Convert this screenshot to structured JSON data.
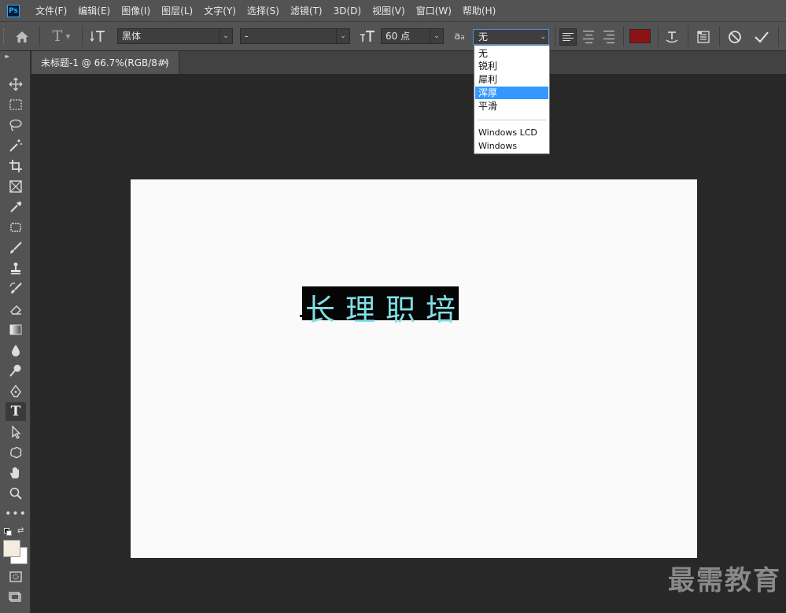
{
  "app": {
    "logo_text": "Ps"
  },
  "menu": [
    "文件(F)",
    "编辑(E)",
    "图像(I)",
    "图层(L)",
    "文字(Y)",
    "选择(S)",
    "滤镜(T)",
    "3D(D)",
    "视图(V)",
    "窗口(W)",
    "帮助(H)"
  ],
  "options_bar": {
    "font_family": "黑体",
    "font_style": "-",
    "font_size": "60 点",
    "antialias_label": "a",
    "antialias_label_small": "a",
    "antialias_value": "无",
    "text_color": "#8b1217"
  },
  "antialias_dropdown": {
    "items": [
      "无",
      "锐利",
      "犀利",
      "浑厚",
      "平滑"
    ],
    "selected_index": 3,
    "extra_items": [
      "Windows LCD",
      "Windows"
    ]
  },
  "document_tab": {
    "title": "未标题-1 @ 66.7%(RGB/8#)",
    "close": "×"
  },
  "canvas": {
    "text": "长理职培"
  },
  "watermark": "最需教育",
  "colors": {
    "foreground": "#f3ecdf",
    "background": "#ffffff",
    "accent": "#3399ff"
  }
}
